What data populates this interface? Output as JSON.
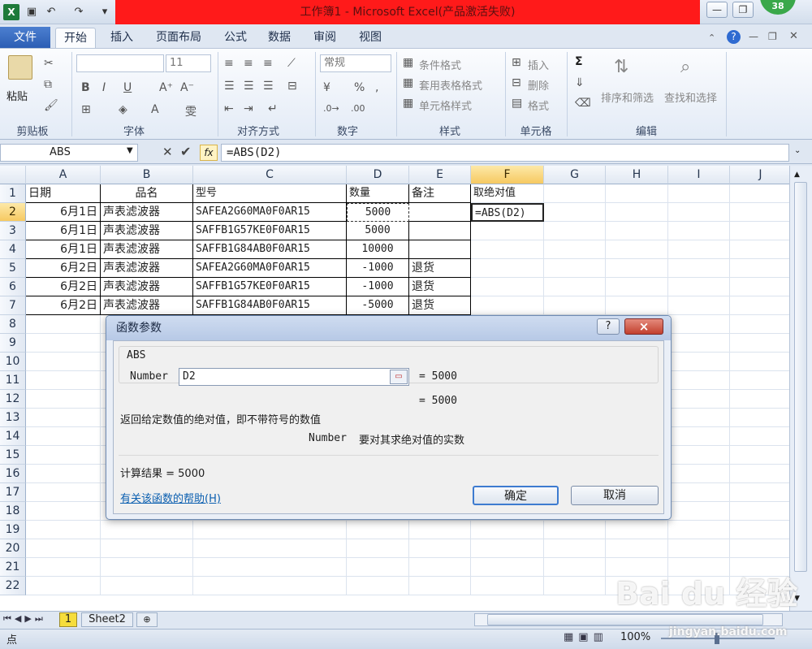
{
  "window": {
    "title": "工作簿1 - Microsoft Excel(产品激活失败)",
    "avatar_badge": "38"
  },
  "ribbon": {
    "tabs": [
      "文件",
      "开始",
      "插入",
      "页面布局",
      "公式",
      "数据",
      "审阅",
      "视图"
    ],
    "active_tab": "开始",
    "clipboard": {
      "paste": "粘贴",
      "label": "剪贴板"
    },
    "font": {
      "size": "11",
      "label": "字体",
      "bold": "B",
      "italic": "I",
      "underline": "U"
    },
    "alignment": {
      "label": "对齐方式"
    },
    "number": {
      "format": "常规",
      "label": "数字",
      "percent": "%"
    },
    "styles": {
      "conditional": "条件格式",
      "table": "套用表格格式",
      "cell": "单元格样式",
      "label": "样式"
    },
    "cells": {
      "insert": "插入",
      "delete": "删除",
      "format": "格式",
      "label": "单元格"
    },
    "editing": {
      "sum": "Σ",
      "sort": "排序和筛选",
      "find": "查找和选择",
      "label": "编辑"
    }
  },
  "formula_bar": {
    "name_box": "ABS",
    "fx": "fx",
    "formula": "=ABS(D2)"
  },
  "sheet": {
    "columns": [
      "A",
      "B",
      "C",
      "D",
      "E",
      "F",
      "G",
      "H",
      "I",
      "J"
    ],
    "rows": [
      "1",
      "2",
      "3",
      "4",
      "5",
      "6",
      "7",
      "8",
      "9",
      "10",
      "11",
      "12",
      "13",
      "14",
      "15",
      "16",
      "17",
      "18",
      "19",
      "20",
      "21",
      "22"
    ],
    "header": {
      "A": "日期",
      "B": "品名",
      "C": "型号",
      "D": "数量",
      "E": "备注",
      "F": "取绝对值"
    },
    "data": [
      {
        "A": "6月1日",
        "B": "声表滤波器",
        "C": "SAFEA2G60MA0F0AR15",
        "D": "5000",
        "E": "",
        "F": "=ABS(D2)"
      },
      {
        "A": "6月1日",
        "B": "声表滤波器",
        "C": "SAFFB1G57KE0F0AR15",
        "D": "5000",
        "E": "",
        "F": ""
      },
      {
        "A": "6月1日",
        "B": "声表滤波器",
        "C": "SAFFB1G84AB0F0AR15",
        "D": "10000",
        "E": "",
        "F": ""
      },
      {
        "A": "6月2日",
        "B": "声表滤波器",
        "C": "SAFEA2G60MA0F0AR15",
        "D": "-1000",
        "E": "退货",
        "F": ""
      },
      {
        "A": "6月2日",
        "B": "声表滤波器",
        "C": "SAFFB1G57KE0F0AR15",
        "D": "-1000",
        "E": "退货",
        "F": ""
      },
      {
        "A": "6月2日",
        "B": "声表滤波器",
        "C": "SAFFB1G84AB0F0AR15",
        "D": "-5000",
        "E": "退货",
        "F": ""
      }
    ],
    "tabs": [
      "1",
      "Sheet2"
    ]
  },
  "dialog": {
    "title": "函数参数",
    "help_glyph": "?",
    "close_glyph": "×",
    "function_name": "ABS",
    "arg_label": "Number",
    "arg_value": "D2",
    "arg_result": "=  5000",
    "result_line": "=  5000",
    "description": "返回给定数值的绝对值，即不带符号的数值",
    "arg_desc_name": "Number",
    "arg_desc_text": "要对其求绝对值的实数",
    "calc_result": "计算结果 =  5000",
    "help_link": "有关该函数的帮助(H)",
    "ok": "确定",
    "cancel": "取消"
  },
  "status": {
    "mode": "点",
    "zoom": "100%"
  },
  "watermark": {
    "logo": "Bai du 经验",
    "url": "jingyan.baidu.com"
  }
}
